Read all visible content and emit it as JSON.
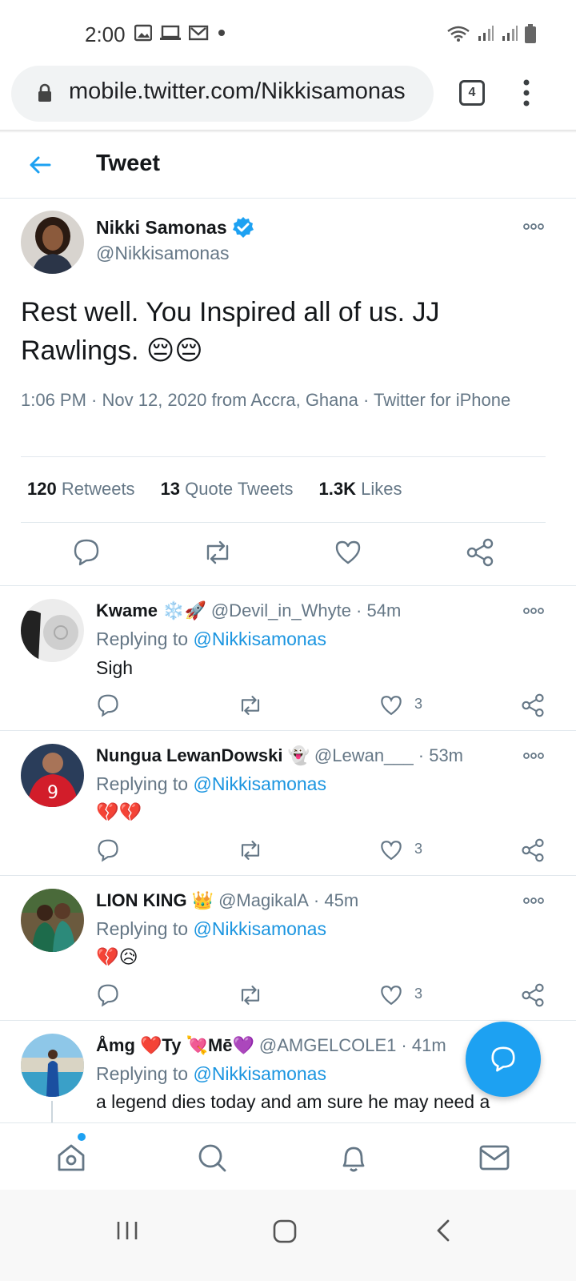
{
  "status_bar": {
    "time": "2:00"
  },
  "browser": {
    "url": "mobile.twitter.com/Nikkisamonas",
    "tab_count": "4"
  },
  "header": {
    "title": "Tweet"
  },
  "main_tweet": {
    "name": "Nikki Samonas",
    "handle": "@Nikkisamonas",
    "text": "Rest well. You Inspired all of us. JJ Rawlings. 😔😔",
    "meta": "1:06 PM · Nov 12, 2020 from Accra, Ghana · Twitter for iPhone",
    "stats": [
      {
        "count": "120",
        "label": "Retweets"
      },
      {
        "count": "13",
        "label": "Quote Tweets"
      },
      {
        "count": "1.3K",
        "label": "Likes"
      }
    ]
  },
  "replies": [
    {
      "name": "Kwame",
      "name_emoji": "❄️🚀",
      "handle": "@Devil_in_Whyte",
      "time": "· 54m",
      "replying_prefix": "Replying to",
      "replying_to": "@Nikkisamonas",
      "text": "Sigh",
      "likes": "3"
    },
    {
      "name": "Nungua LewanDowski",
      "name_emoji": "👻",
      "handle": "@Lewan___",
      "time": "· 53m",
      "replying_prefix": "Replying to",
      "replying_to": "@Nikkisamonas",
      "text": "💔💔",
      "likes": "3"
    },
    {
      "name": "LION KING",
      "name_emoji": "👑",
      "handle": "@MagikalA",
      "time": "· 45m",
      "replying_prefix": "Replying to",
      "replying_to": "@Nikkisamonas",
      "text": "💔😥",
      "likes": "3"
    },
    {
      "name": "Åmg ❤️Ty 💘Mē💜",
      "name_emoji": "",
      "handle": "@AMGELCOLE1",
      "time": "· 41m",
      "replying_prefix": "Replying to",
      "replying_to": "@Nikkisamonas",
      "text": "a legend dies today and am sure he may need a",
      "likes": ""
    }
  ],
  "colors": {
    "accent": "#1da1f2",
    "secondary_text": "#657786",
    "divider": "#e1e8ed"
  }
}
